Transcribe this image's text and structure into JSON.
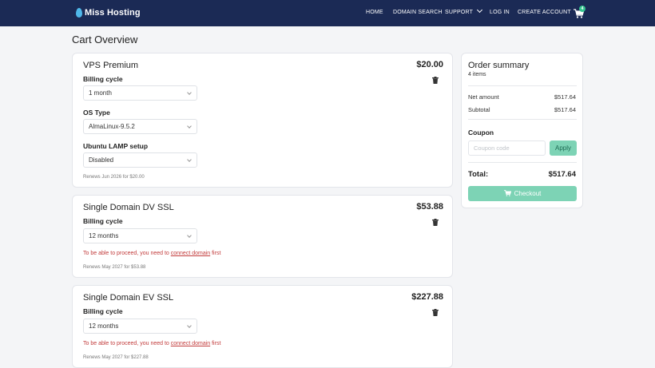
{
  "brand": {
    "name": "Miss Hosting",
    "accent": "#4fb8ea",
    "navbar_color": "#1b2a55"
  },
  "nav": {
    "home": "HOME",
    "domain_search": "DOMAIN SEARCH",
    "support": "SUPPORT",
    "login": "LOG IN",
    "create_account": "CREATE ACCOUNT",
    "cart_count": "4"
  },
  "page": {
    "title": "Cart Overview"
  },
  "items": [
    {
      "title": "VPS Premium",
      "price": "$20.00",
      "fields": [
        {
          "label": "Billing cycle",
          "value": "1 month"
        },
        {
          "label": "OS Type",
          "value": "AlmaLinux-9.5.2"
        },
        {
          "label": "Ubuntu LAMP setup",
          "value": "Disabled"
        }
      ],
      "renews": "Renews Jun 2026 for $20.00"
    },
    {
      "title": "Single Domain DV SSL",
      "price": "$53.88",
      "fields": [
        {
          "label": "Billing cycle",
          "value": "12 months"
        }
      ],
      "warning": {
        "before": "To be able to proceed, you need to ",
        "link": "connect domain",
        "after": " first"
      },
      "renews": "Renews May 2027 for $53.88"
    },
    {
      "title": "Single Domain EV SSL",
      "price": "$227.88",
      "fields": [
        {
          "label": "Billing cycle",
          "value": "12 months"
        }
      ],
      "warning": {
        "before": "To be able to proceed, you need to ",
        "link": "connect domain",
        "after": " first"
      },
      "renews": "Renews May 2027 for $227.88"
    }
  ],
  "summary": {
    "title": "Order summary",
    "count": "4 items",
    "net_label": "Net amount",
    "net_value": "$517.64",
    "subtotal_label": "Subtotal",
    "subtotal_value": "$517.64",
    "coupon_label": "Coupon",
    "coupon_placeholder": "Coupon code",
    "apply_label": "Apply",
    "total_label": "Total:",
    "total_value": "$517.64",
    "checkout_label": "Checkout",
    "button_color": "#7dd3b5"
  }
}
